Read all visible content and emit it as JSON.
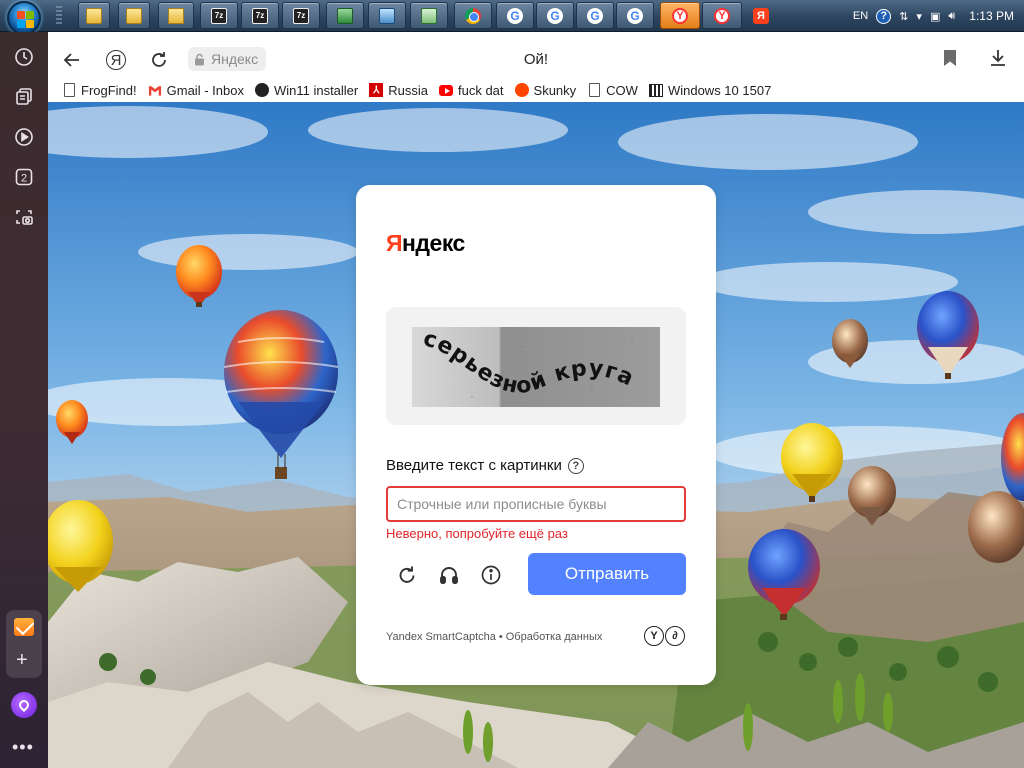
{
  "taskbar": {
    "items": [
      {
        "icon": "folder-icon"
      },
      {
        "icon": "folder-icon"
      },
      {
        "icon": "explorer-icon"
      },
      {
        "icon": "7zip-icon",
        "text": "7z"
      },
      {
        "icon": "7zip-icon",
        "text": "7z"
      },
      {
        "icon": "7zip-icon",
        "text": "7z"
      },
      {
        "icon": "app-icon"
      },
      {
        "icon": "monitor-icon"
      },
      {
        "icon": "network-icon"
      },
      {
        "icon": "chrome-icon"
      },
      {
        "icon": "google-icon",
        "text": "G"
      },
      {
        "icon": "google-icon",
        "text": "G"
      },
      {
        "icon": "google-icon",
        "text": "G"
      },
      {
        "icon": "google-icon",
        "text": "G"
      },
      {
        "icon": "yandex-browser-icon",
        "text": "Y"
      },
      {
        "icon": "yandex-browser-icon",
        "text": "Y"
      },
      {
        "icon": "yandex-icon",
        "text": "Я"
      }
    ],
    "tray": {
      "language": "EN",
      "help": "?",
      "time": "1:13 PM"
    }
  },
  "sidebar": {
    "icons": [
      "history-icon",
      "tabs-icon",
      "play-icon",
      "number-2-icon",
      "screenshot-icon"
    ],
    "number_label": "2",
    "more": "•••"
  },
  "browser": {
    "yandex_button": "Я",
    "site_chip": "Яндекс",
    "page_title": "Ой!",
    "bookmarks": [
      {
        "label": "FrogFind!",
        "icon": "document-icon"
      },
      {
        "label": "Gmail - Inbox",
        "icon": "gmail-icon"
      },
      {
        "label": "Win11 installer",
        "icon": "github-icon"
      },
      {
        "label": "Russia",
        "icon": "flag-icon"
      },
      {
        "label": "fuck dat",
        "icon": "youtube-icon"
      },
      {
        "label": "Skunky",
        "icon": "reddit-icon"
      },
      {
        "label": "COW",
        "icon": "document-icon"
      },
      {
        "label": "Windows 10 1507",
        "icon": "windows-icon"
      }
    ]
  },
  "captcha": {
    "logo_first": "Я",
    "logo_rest": "ндекс",
    "image_text": "серьезной круга",
    "prompt": "Введите текст с картинки",
    "help_symbol": "?",
    "placeholder": "Строчные или прописные буквы",
    "value": "",
    "error": "Неверно, попробуйте ещё раз",
    "actions": [
      "refresh-icon",
      "audio-icon",
      "info-icon"
    ],
    "submit_label": "Отправить",
    "footer_brand": "Yandex SmartCaptcha",
    "footer_sep": "•",
    "footer_link": "Обработка данных",
    "footer_logo": [
      "Y",
      "∂"
    ]
  },
  "colors": {
    "accent": "#5282ff",
    "error": "#e0262a",
    "yandex_red": "#fc3f1d"
  }
}
